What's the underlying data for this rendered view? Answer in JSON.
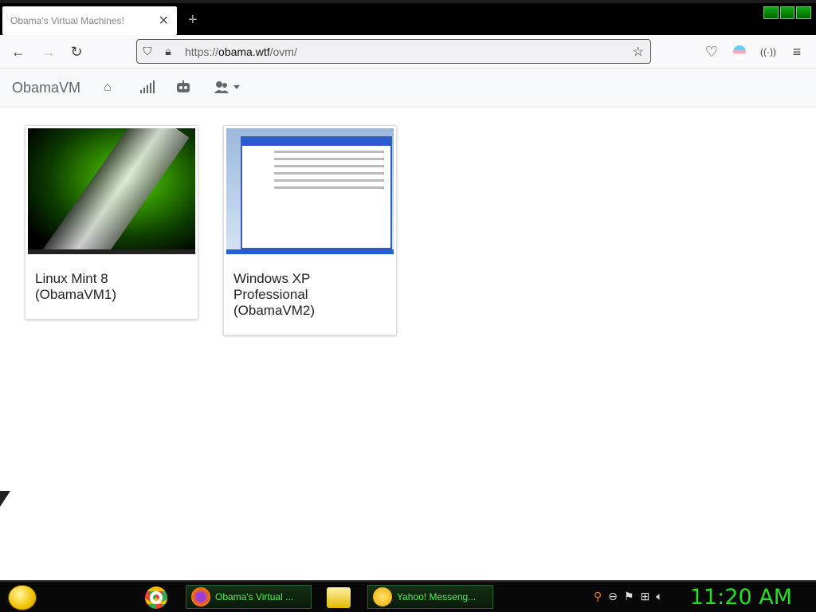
{
  "browser": {
    "tab_title": "Obama's Virtual Machines!",
    "tab_close": "✕",
    "new_tab": "+",
    "url_prefix": "https://",
    "url_domain": "obama.wtf",
    "url_path": "/ovm/"
  },
  "site": {
    "brand": "ObamaVM",
    "nav": {
      "home": "⌂",
      "stats": "▮",
      "bot": "◉",
      "users": "☻ ▾"
    }
  },
  "vms": [
    {
      "caption": "Linux Mint 8 (ObamaVM1)"
    },
    {
      "caption": "Windows XP Professional (ObamaVM2)"
    }
  ],
  "taskbar": {
    "firefox_label": "Obama's Virtual ...",
    "yahoo_label": "Yahoo! Messeng...",
    "clock": "11:20 AM"
  }
}
